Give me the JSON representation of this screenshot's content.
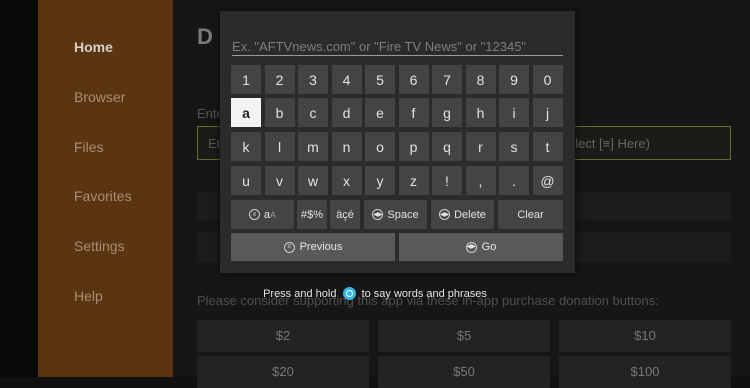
{
  "sidebar": {
    "items": [
      {
        "label": "Home",
        "active": true
      },
      {
        "label": "Browser",
        "active": false
      },
      {
        "label": "Files",
        "active": false
      },
      {
        "label": "Favorites",
        "active": false
      },
      {
        "label": "Settings",
        "active": false
      },
      {
        "label": "Help",
        "active": false
      }
    ]
  },
  "background": {
    "logo_glyph": "D",
    "enter_label": "Ente",
    "url_box_left": "Et",
    "url_box_right": "lect [≡] Here)",
    "donate_text": "Please consider supporting this app via these in-app purchase donation buttons:",
    "donations": [
      "$2",
      "$5",
      "$10",
      "$20",
      "$50",
      "$100"
    ]
  },
  "keyboard": {
    "input": {
      "value": "",
      "placeholder": "Ex. \"AFTVnews.com\" or \"Fire TV News\" or \"12345\""
    },
    "rows": [
      [
        "1",
        "2",
        "3",
        "4",
        "5",
        "6",
        "7",
        "8",
        "9",
        "0"
      ],
      [
        "a",
        "b",
        "c",
        "d",
        "e",
        "f",
        "g",
        "h",
        "i",
        "j"
      ],
      [
        "k",
        "l",
        "m",
        "n",
        "o",
        "p",
        "q",
        "r",
        "s",
        "t"
      ],
      [
        "u",
        "v",
        "w",
        "x",
        "y",
        "z",
        "!",
        ",",
        ".",
        "@"
      ]
    ],
    "selected_key": "a",
    "function_keys": {
      "case": {
        "label": "a",
        "suffix": "A"
      },
      "symbols": "#$%",
      "accents": "äçé",
      "space": "Space",
      "delete": "Delete",
      "clear": "Clear"
    },
    "previous_label": "Previous",
    "go_label": "Go"
  },
  "hint": {
    "before": "Press and hold",
    "after": "to say words and phrases"
  },
  "colors": {
    "sidebar_bg": "#5a3510",
    "keyboard_bg": "#2b2b2b",
    "key_bg": "#444444",
    "selected_key_bg": "#f3f3f3",
    "mic_accent": "#36b8e6"
  }
}
